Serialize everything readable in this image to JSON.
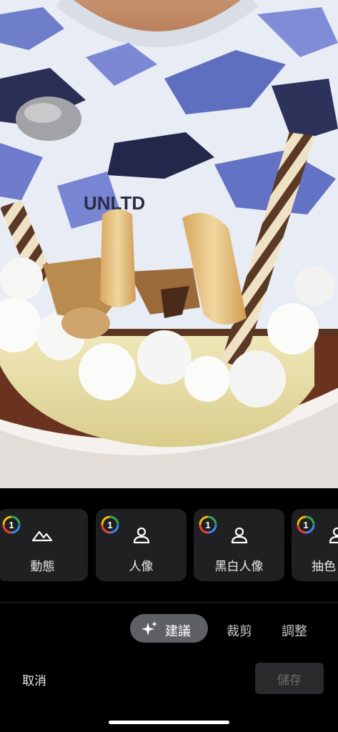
{
  "photo": {
    "shirt_text": "UNLTD"
  },
  "suggestions": [
    {
      "label": "動態",
      "badge": "1",
      "icon": "mountain-icon"
    },
    {
      "label": "人像",
      "badge": "1",
      "icon": "person-icon"
    },
    {
      "label": "黑白人像",
      "badge": "1",
      "icon": "person-icon"
    },
    {
      "label": "抽色",
      "badge": "1",
      "icon": "person-icon"
    }
  ],
  "tabs": {
    "active": {
      "label": "建議",
      "icon": "sparkle-icon"
    },
    "items": [
      "裁剪",
      "調整"
    ]
  },
  "actions": {
    "cancel": "取消",
    "save": "儲存"
  }
}
